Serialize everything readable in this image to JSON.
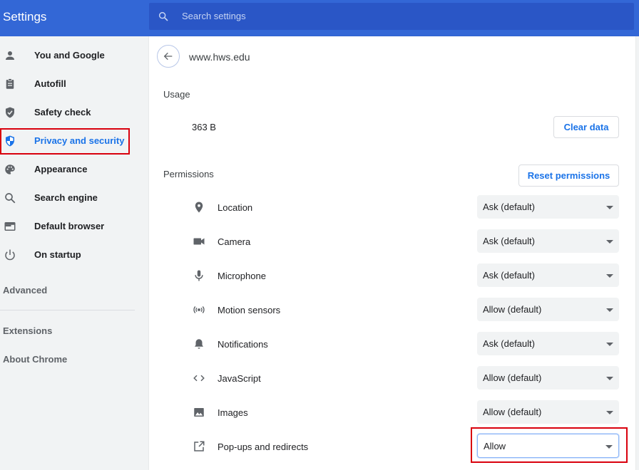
{
  "header": {
    "title": "Settings",
    "search_placeholder": "Search settings"
  },
  "sidebar": {
    "items": [
      {
        "label": "You and Google",
        "icon": "person-icon"
      },
      {
        "label": "Autofill",
        "icon": "clipboard-icon"
      },
      {
        "label": "Safety check",
        "icon": "shield-check-icon"
      },
      {
        "label": "Privacy and security",
        "icon": "shield-icon",
        "active": true
      },
      {
        "label": "Appearance",
        "icon": "palette-icon"
      },
      {
        "label": "Search engine",
        "icon": "search-icon"
      },
      {
        "label": "Default browser",
        "icon": "browser-icon"
      },
      {
        "label": "On startup",
        "icon": "power-icon"
      }
    ],
    "advanced": "Advanced",
    "extensions": "Extensions",
    "about": "About Chrome"
  },
  "site": {
    "title": "www.hws.edu",
    "usage_label": "Usage",
    "usage_value": "363 B",
    "clear_data": "Clear data",
    "permissions_label": "Permissions",
    "reset_permissions": "Reset permissions"
  },
  "permissions": [
    {
      "label": "Location",
      "value": "Ask (default)",
      "icon": "location-pin-icon"
    },
    {
      "label": "Camera",
      "value": "Ask (default)",
      "icon": "camera-icon"
    },
    {
      "label": "Microphone",
      "value": "Ask (default)",
      "icon": "microphone-icon"
    },
    {
      "label": "Motion sensors",
      "value": "Allow (default)",
      "icon": "motion-sensor-icon"
    },
    {
      "label": "Notifications",
      "value": "Ask (default)",
      "icon": "bell-icon"
    },
    {
      "label": "JavaScript",
      "value": "Allow (default)",
      "icon": "code-icon"
    },
    {
      "label": "Images",
      "value": "Allow (default)",
      "icon": "image-icon"
    },
    {
      "label": "Pop-ups and redirects",
      "value": "Allow",
      "icon": "open-in-new-icon"
    }
  ],
  "colors": {
    "header": "#3367d6",
    "accent": "#1a73e8",
    "highlight": "#d9000d"
  }
}
